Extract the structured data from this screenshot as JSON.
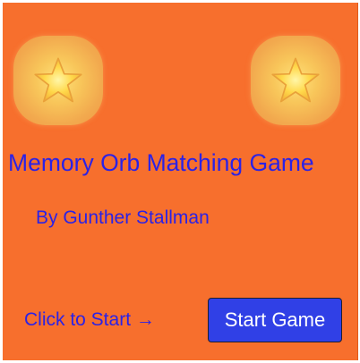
{
  "game": {
    "title": "Memory Orb Matching Game",
    "author": "By Gunther Stallman",
    "start_hint": "Click to Start →",
    "start_button_label": "Start Game"
  },
  "orbs": [
    {
      "icon": "star-icon"
    },
    {
      "icon": "star-icon"
    }
  ],
  "colors": {
    "background": "#f76f2d",
    "text": "#2b22e6",
    "button": "#3040e6",
    "button_text": "#ffffff",
    "orb_glow": "#ffe27a"
  }
}
